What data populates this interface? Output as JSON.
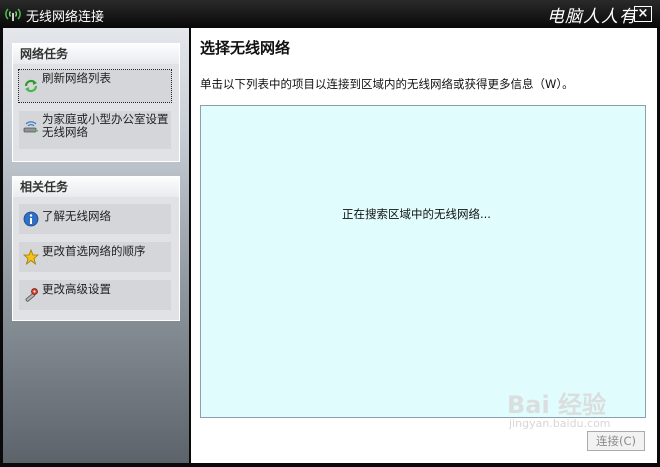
{
  "window": {
    "title": "无线网络连接",
    "brand": "电脑人人有",
    "close_label": "×"
  },
  "sidebar": {
    "network_tasks": {
      "header": "网络任务",
      "items": [
        {
          "label": "刷新网络列表",
          "icon": "refresh-icon"
        },
        {
          "label": "为家庭或小型办公室设置无线网络",
          "icon": "wireless-setup-icon"
        }
      ]
    },
    "related_tasks": {
      "header": "相关任务",
      "items": [
        {
          "label": "了解无线网络",
          "icon": "info-icon"
        },
        {
          "label": "更改首选网络的顺序",
          "icon": "star-icon"
        },
        {
          "label": "更改高级设置",
          "icon": "settings-icon"
        }
      ]
    }
  },
  "main": {
    "title": "选择无线网络",
    "description": "单击以下列表中的项目以连接到区域内的无线网络或获得更多信息（W）。",
    "list_status": "正在搜索区域中的无线网络...",
    "connect_label": "连接(C)"
  },
  "watermark": {
    "logo": "Bai 经验",
    "sub": "jingyan.baidu.com"
  },
  "colors": {
    "list_background": "#e0fcfd",
    "titlebar": "#111111",
    "sidebar_panel": "#e0e2e5"
  }
}
